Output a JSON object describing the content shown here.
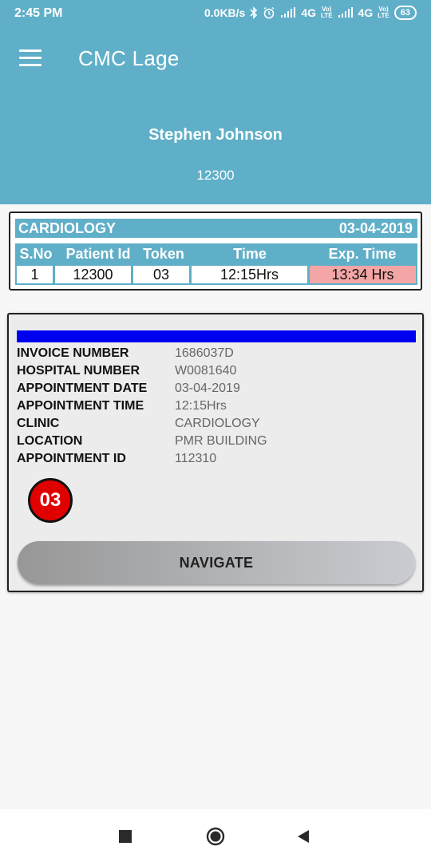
{
  "status_bar": {
    "time": "2:45 PM",
    "data_speed": "0.0KB/s",
    "network1": "4G",
    "network2": "4G",
    "volte_top": "Vo)",
    "volte_bottom": "LTE",
    "battery": "63"
  },
  "app": {
    "title": "CMC Lage",
    "accent_color": "#60afc8"
  },
  "patient": {
    "name": "Stephen Johnson",
    "id": "12300"
  },
  "summary": {
    "department": "CARDIOLOGY",
    "date": "03-04-2019",
    "columns": [
      "S.No",
      "Patient Id",
      "Token",
      "Time",
      "Exp. Time"
    ],
    "row": [
      "1",
      "12300",
      "03",
      "12:15Hrs",
      "13:34 Hrs"
    ]
  },
  "details": {
    "fields": [
      {
        "label": "INVOICE NUMBER",
        "value": "1686037D"
      },
      {
        "label": "HOSPITAL NUMBER",
        "value": "W0081640"
      },
      {
        "label": "APPOINTMENT DATE",
        "value": "03-04-2019"
      },
      {
        "label": "APPOINTMENT TIME",
        "value": "12:15Hrs"
      },
      {
        "label": "CLINIC",
        "value": "CARDIOLOGY"
      },
      {
        "label": "LOCATION",
        "value": "PMR BUILDING"
      },
      {
        "label": "APPOINTMENT ID",
        "value": "112310"
      }
    ],
    "token": "03",
    "navigate_label": "NAVIGATE"
  },
  "nav_bar": {
    "icons": [
      "recents-icon",
      "home-icon",
      "back-icon"
    ]
  }
}
